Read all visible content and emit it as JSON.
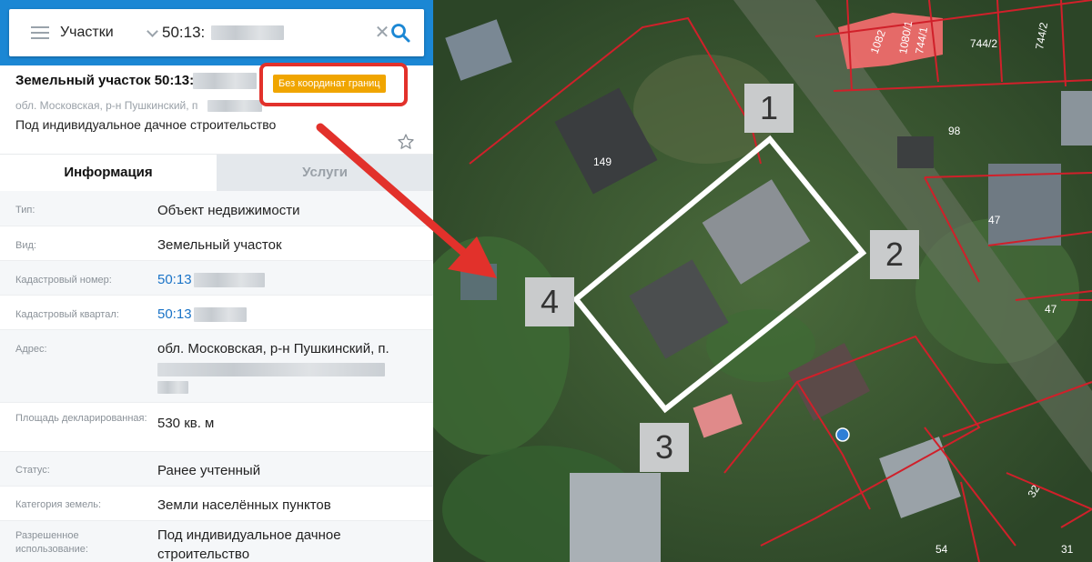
{
  "search": {
    "type_label": "Участки",
    "query": "50:13:"
  },
  "header": {
    "title": "Земельный участок 50:13:",
    "badge": "Без координат границ",
    "region": "обл. Московская, р-н Пушкинский, п",
    "purpose": "Под индивидуальное дачное строительство"
  },
  "tabs": [
    {
      "label": "Информация",
      "active": true
    },
    {
      "label": "Услуги",
      "active": false
    }
  ],
  "rows": [
    {
      "label": "Тип:",
      "value": "Объект недвижимости"
    },
    {
      "label": "Вид:",
      "value": "Земельный участок"
    },
    {
      "label": "Кадастровый номер:",
      "value": "50:13"
    },
    {
      "label": "Кадастровый квартал:",
      "value": "50:13"
    },
    {
      "label": "Адрес:",
      "value": "обл. Московская, р-н Пушкинский, п."
    },
    {
      "label": "Площадь декларированная:",
      "value": "530 кв. м"
    },
    {
      "label": "Статус:",
      "value": "Ранее учтенный"
    },
    {
      "label": "Категория земель:",
      "value": "Земли населённых пунктов"
    },
    {
      "label": "Разрешенное использование:",
      "value": "Под индивидуальное дачное строительство"
    }
  ],
  "map": {
    "corner_labels": [
      "1",
      "2",
      "3",
      "4"
    ],
    "plot_numbers": [
      "149",
      "1082",
      "1080/1",
      "744/1",
      "744/2",
      "744/2",
      "98",
      "47",
      "47",
      "54",
      "31",
      "32"
    ]
  },
  "colors": {
    "header_blue": "#1b87d4",
    "badge_orange": "#f0a500",
    "highlight_red": "#e2312b",
    "link_blue": "#1a73c7",
    "boundary_red": "#d0202a",
    "parcel_fill": "#ef6b6b"
  }
}
